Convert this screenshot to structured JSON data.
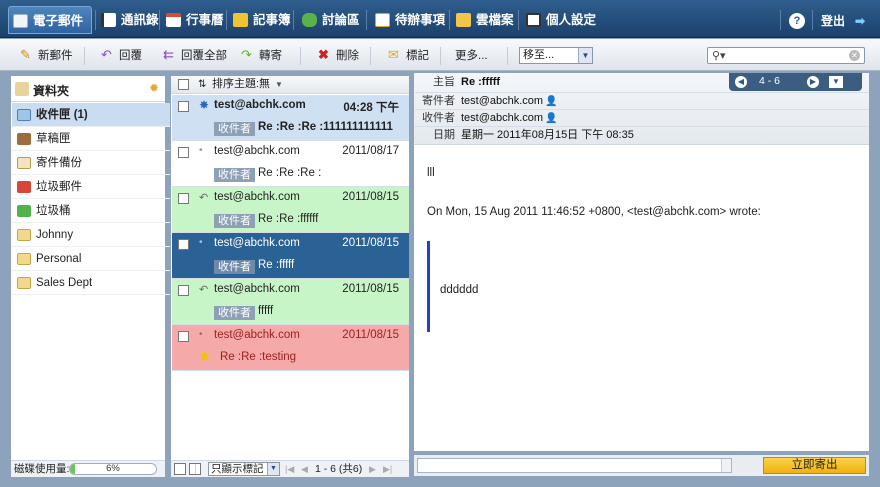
{
  "nav": {
    "tabs": [
      {
        "label": "電子郵件",
        "icon": "mail-icon",
        "color": "#f2f5f8"
      },
      {
        "label": "通訊錄",
        "icon": "address-book-icon",
        "color": "#ffffff"
      },
      {
        "label": "行事曆",
        "icon": "calendar-icon",
        "color": "#d94a3c"
      },
      {
        "label": "記事簿",
        "icon": "notepad-icon",
        "color": "#f1c232"
      },
      {
        "label": "討論區",
        "icon": "forum-icon",
        "color": "#59b34a"
      },
      {
        "label": "待辦事項",
        "icon": "todo-icon",
        "color": "#ffffff"
      },
      {
        "label": "雲檔案",
        "icon": "cloud-folder-icon",
        "color": "#f3c54a"
      },
      {
        "label": "個人設定",
        "icon": "settings-icon",
        "color": "#ffffff"
      }
    ],
    "help_icon": "help-icon",
    "logout_label": "登出"
  },
  "toolbar": {
    "new_label": "新郵件",
    "reply_label": "回覆",
    "reply_all_label": "回覆全部",
    "forward_label": "轉寄",
    "delete_label": "刪除",
    "mark_label": "標記",
    "more_label": "更多...",
    "move_select": "移至...",
    "search_value": ""
  },
  "folders": {
    "title": "資料夾",
    "items": [
      {
        "label": "收件匣 (1)",
        "icon": "inbox-icon",
        "selected": true
      },
      {
        "label": "草稿匣",
        "icon": "drafts-icon",
        "selected": false
      },
      {
        "label": "寄件備份",
        "icon": "sent-icon",
        "selected": false
      },
      {
        "label": "垃圾郵件",
        "icon": "spam-icon",
        "selected": false
      },
      {
        "label": "垃圾桶",
        "icon": "trash-icon",
        "selected": false
      },
      {
        "label": "Johnny",
        "icon": "folder-icon",
        "selected": false
      },
      {
        "label": "Personal",
        "icon": "folder-icon",
        "selected": false
      },
      {
        "label": "Sales Dept",
        "icon": "folder-icon",
        "selected": false
      }
    ],
    "disk_label": "磁碟使用量:",
    "disk_percent": "6%"
  },
  "messages": {
    "sort_label": "排序主題:無",
    "items": [
      {
        "from": "test@abchk.com",
        "date": "04:28 下午",
        "recipient_tag": "收件者",
        "subject": "Re :Re :Re :111111111111",
        "bg": "#cfe0f3",
        "unread": true,
        "star": false
      },
      {
        "from": "test@abchk.com",
        "date": "2011/08/17",
        "recipient_tag": "收件者",
        "subject": "Re :Re :Re :",
        "bg": "#ffffff",
        "unread": false,
        "star": false
      },
      {
        "from": "test@abchk.com",
        "date": "2011/08/15",
        "recipient_tag": "收件者",
        "subject": "Re :Re :ffffff",
        "bg": "#c8f5c8",
        "unread": false,
        "star": false
      },
      {
        "from": "test@abchk.com",
        "date": "2011/08/15",
        "recipient_tag": "收件者",
        "subject": "Re :fffff",
        "bg": "#2a6296",
        "unread": false,
        "star": false
      },
      {
        "from": "test@abchk.com",
        "date": "2011/08/15",
        "recipient_tag": "收件者",
        "subject": "fffff",
        "bg": "#c8f5c8",
        "unread": false,
        "star": false
      },
      {
        "from": "test@abchk.com",
        "date": "2011/08/15",
        "recipient_tag": "",
        "subject": "Re :Re :testing",
        "bg": "#f6a9a9",
        "unread": false,
        "star": true
      }
    ],
    "filter_select": "只顯示標記",
    "pager": "1 - 6 (共6)"
  },
  "reading": {
    "subject_label": "主旨",
    "subject": "Re :fffff",
    "from_label": "寄件者",
    "from": "test@abchk.com",
    "to_label": "收件者",
    "to": "test@abchk.com",
    "date_label": "日期",
    "date": "星期一 2011年08月15日 下午 08:35",
    "nav_count": "4 - 6",
    "body_line1": "lll",
    "body_line2": "On Mon, 15 Aug 2011 11:46:52 +0800, <test@abchk.com> wrote:",
    "quote": "dddddd",
    "quick_reply_value": "",
    "send_label": "立即寄出"
  }
}
